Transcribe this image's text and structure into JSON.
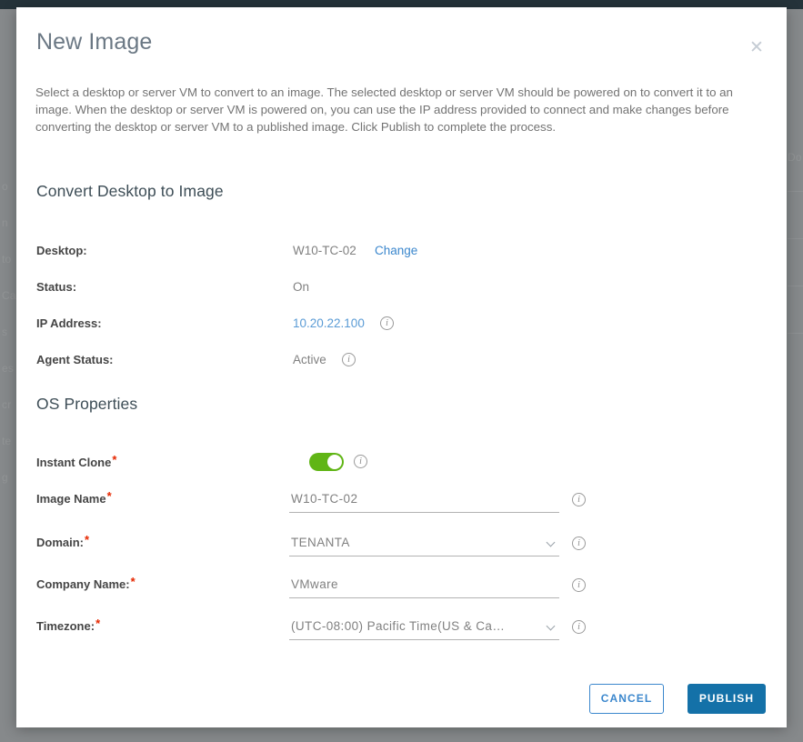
{
  "modal": {
    "title": "New Image",
    "close_icon": "close-icon",
    "description": "Select a desktop or server VM to convert to an image. The selected desktop or server VM should be powered on to convert it to an image. When the desktop or server VM is powered on, you can use the IP address provided to connect and make changes before converting the desktop or server VM to a published image. Click Publish to complete the process."
  },
  "convert_section": {
    "heading": "Convert Desktop to Image",
    "rows": [
      {
        "label": "Desktop:",
        "value": "W10-TC-02",
        "action_label": "Change",
        "has_info": false
      },
      {
        "label": "Status:",
        "value": "On",
        "has_info": false
      },
      {
        "label": "IP Address:",
        "value": "10.20.22.100",
        "is_link": true,
        "has_info": true
      },
      {
        "label": "Agent Status:",
        "value": "Active",
        "has_info": true
      }
    ]
  },
  "os_properties": {
    "heading": "OS Properties",
    "fields": [
      {
        "label": "Instant Clone",
        "required": true,
        "type": "toggle",
        "value": "on",
        "has_info": true
      },
      {
        "label": "Image Name",
        "required": true,
        "type": "text",
        "value": "W10-TC-02",
        "has_info": true
      },
      {
        "label": "Domain:",
        "required": true,
        "type": "select",
        "value": "TENANTA",
        "has_info": true
      },
      {
        "label": "Company Name:",
        "required": true,
        "type": "text",
        "value": "VMware",
        "has_info": true
      },
      {
        "label": "Timezone:",
        "required": true,
        "type": "select",
        "value": "(UTC-08:00) Pacific Time(US & Ca…",
        "has_info": true
      }
    ]
  },
  "footer": {
    "cancel_label": "CANCEL",
    "publish_label": "PUBLISH"
  },
  "colors": {
    "accent_blue": "#1471a8",
    "link_blue": "#3b87cd",
    "toggle_green": "#60b515",
    "required_red": "#e62700",
    "label_gray": "#454545",
    "value_gray": "#808080"
  },
  "background": {
    "ghost_left": [
      "o",
      "n",
      "to",
      "Ca",
      "s",
      "es",
      "cr",
      "te",
      "g"
    ],
    "ghost_right": [
      "Do"
    ]
  }
}
